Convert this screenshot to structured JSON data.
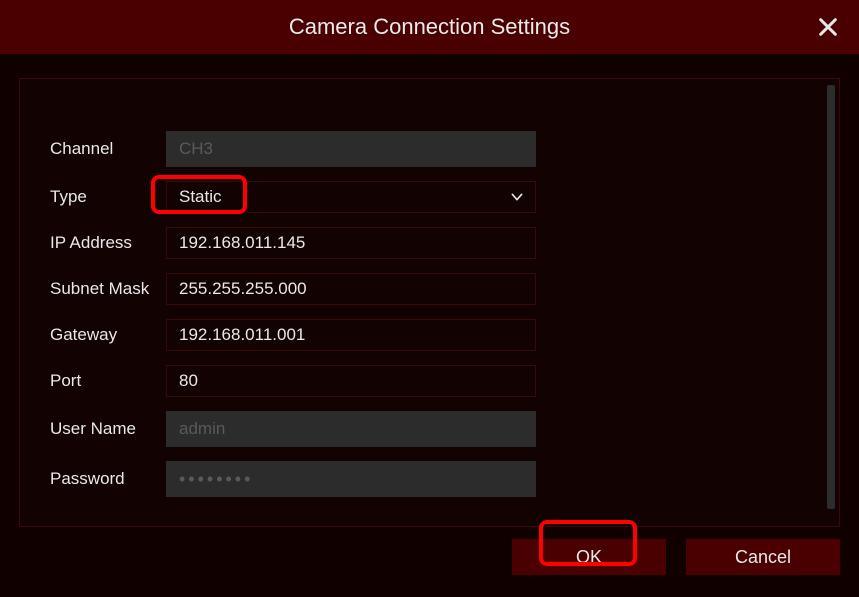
{
  "title": "Camera Connection Settings",
  "form": {
    "channel_label": "Channel",
    "channel_value": "CH3",
    "type_label": "Type",
    "type_value": "Static",
    "ip_label": "IP Address",
    "ip_value": "192.168.011.145",
    "subnet_label": "Subnet Mask",
    "subnet_value": "255.255.255.000",
    "gateway_label": "Gateway",
    "gateway_value": "192.168.011.001",
    "port_label": "Port",
    "port_value": "80",
    "username_label": "User Name",
    "username_value": "admin",
    "password_label": "Password",
    "password_mask": "••••••••"
  },
  "buttons": {
    "ok": "OK",
    "cancel": "Cancel"
  }
}
